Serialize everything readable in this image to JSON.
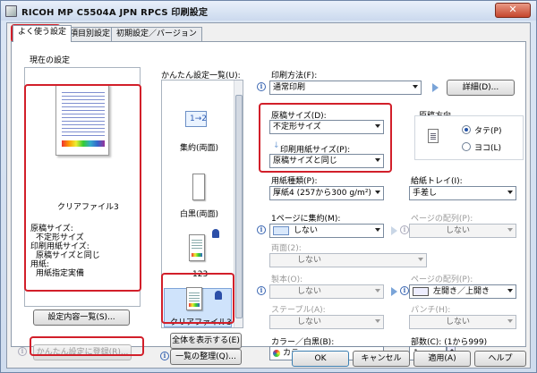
{
  "window": {
    "title": "RICOH MP C5504A JPN RPCS 印刷設定",
    "close_label": "✕"
  },
  "tabs": [
    "よく使う設定",
    "項目別設定",
    "初期設定／バージョン"
  ],
  "current_settings": {
    "heading": "現在の設定",
    "preview_name": "クリアファイル3",
    "details": [
      "原稿サイズ:",
      "不定形サイズ",
      "印刷用紙サイズ:",
      "原稿サイズと同じ",
      "用紙:",
      "用紙指定実備"
    ],
    "list_button": "設定内容一覧(S)...",
    "register_button": "かんたん設定に登録(R)..."
  },
  "easy_settings": {
    "heading": "かんたん設定一覧(U):",
    "items": [
      "集約(両面)",
      "白黒(両面)",
      "123",
      "クリアファイル3"
    ],
    "show_all_button": "全体を表示する(E)",
    "organize_button": "一覧の整理(Q)..."
  },
  "print_method": {
    "label": "印刷方法(F):",
    "value": "通常印刷",
    "detail_button": "詳細(D)..."
  },
  "paper_size": {
    "original_label": "原稿サイズ(D):",
    "original_value": "不定形サイズ",
    "print_label": "印刷用紙サイズ(P):",
    "print_value": "原稿サイズと同じ"
  },
  "orientation": {
    "label": "原稿方向",
    "portrait": "タテ(P)",
    "landscape": "ヨコ(L)",
    "selected": "portrait"
  },
  "paper_type": {
    "label": "用紙種類(P):",
    "value": "厚紙4 (257から300 g/m²)"
  },
  "tray": {
    "label": "給紙トレイ(I):",
    "value": "手差し"
  },
  "combine": {
    "label": "1ページに集約(M):",
    "value": "しない"
  },
  "page_order": {
    "label": "ページの配列(P):",
    "value": "しない"
  },
  "duplex": {
    "label": "両面(2):",
    "value": "しない"
  },
  "booklet": {
    "label": "製本(O):",
    "value": "しない"
  },
  "page_order2": {
    "label": "ページの配列(P):",
    "value": "左開き／上開き"
  },
  "staple": {
    "label": "ステープル(A):",
    "value": "しない"
  },
  "punch": {
    "label": "パンチ(H):",
    "value": "しない"
  },
  "color": {
    "label": "カラー／白黒(B):",
    "value": "カラー"
  },
  "copies": {
    "label": "部数(C): (1から999)",
    "value": "1"
  },
  "footer": {
    "ok": "OK",
    "cancel": "キャンセル",
    "apply": "適用(A)",
    "help": "ヘルプ"
  }
}
